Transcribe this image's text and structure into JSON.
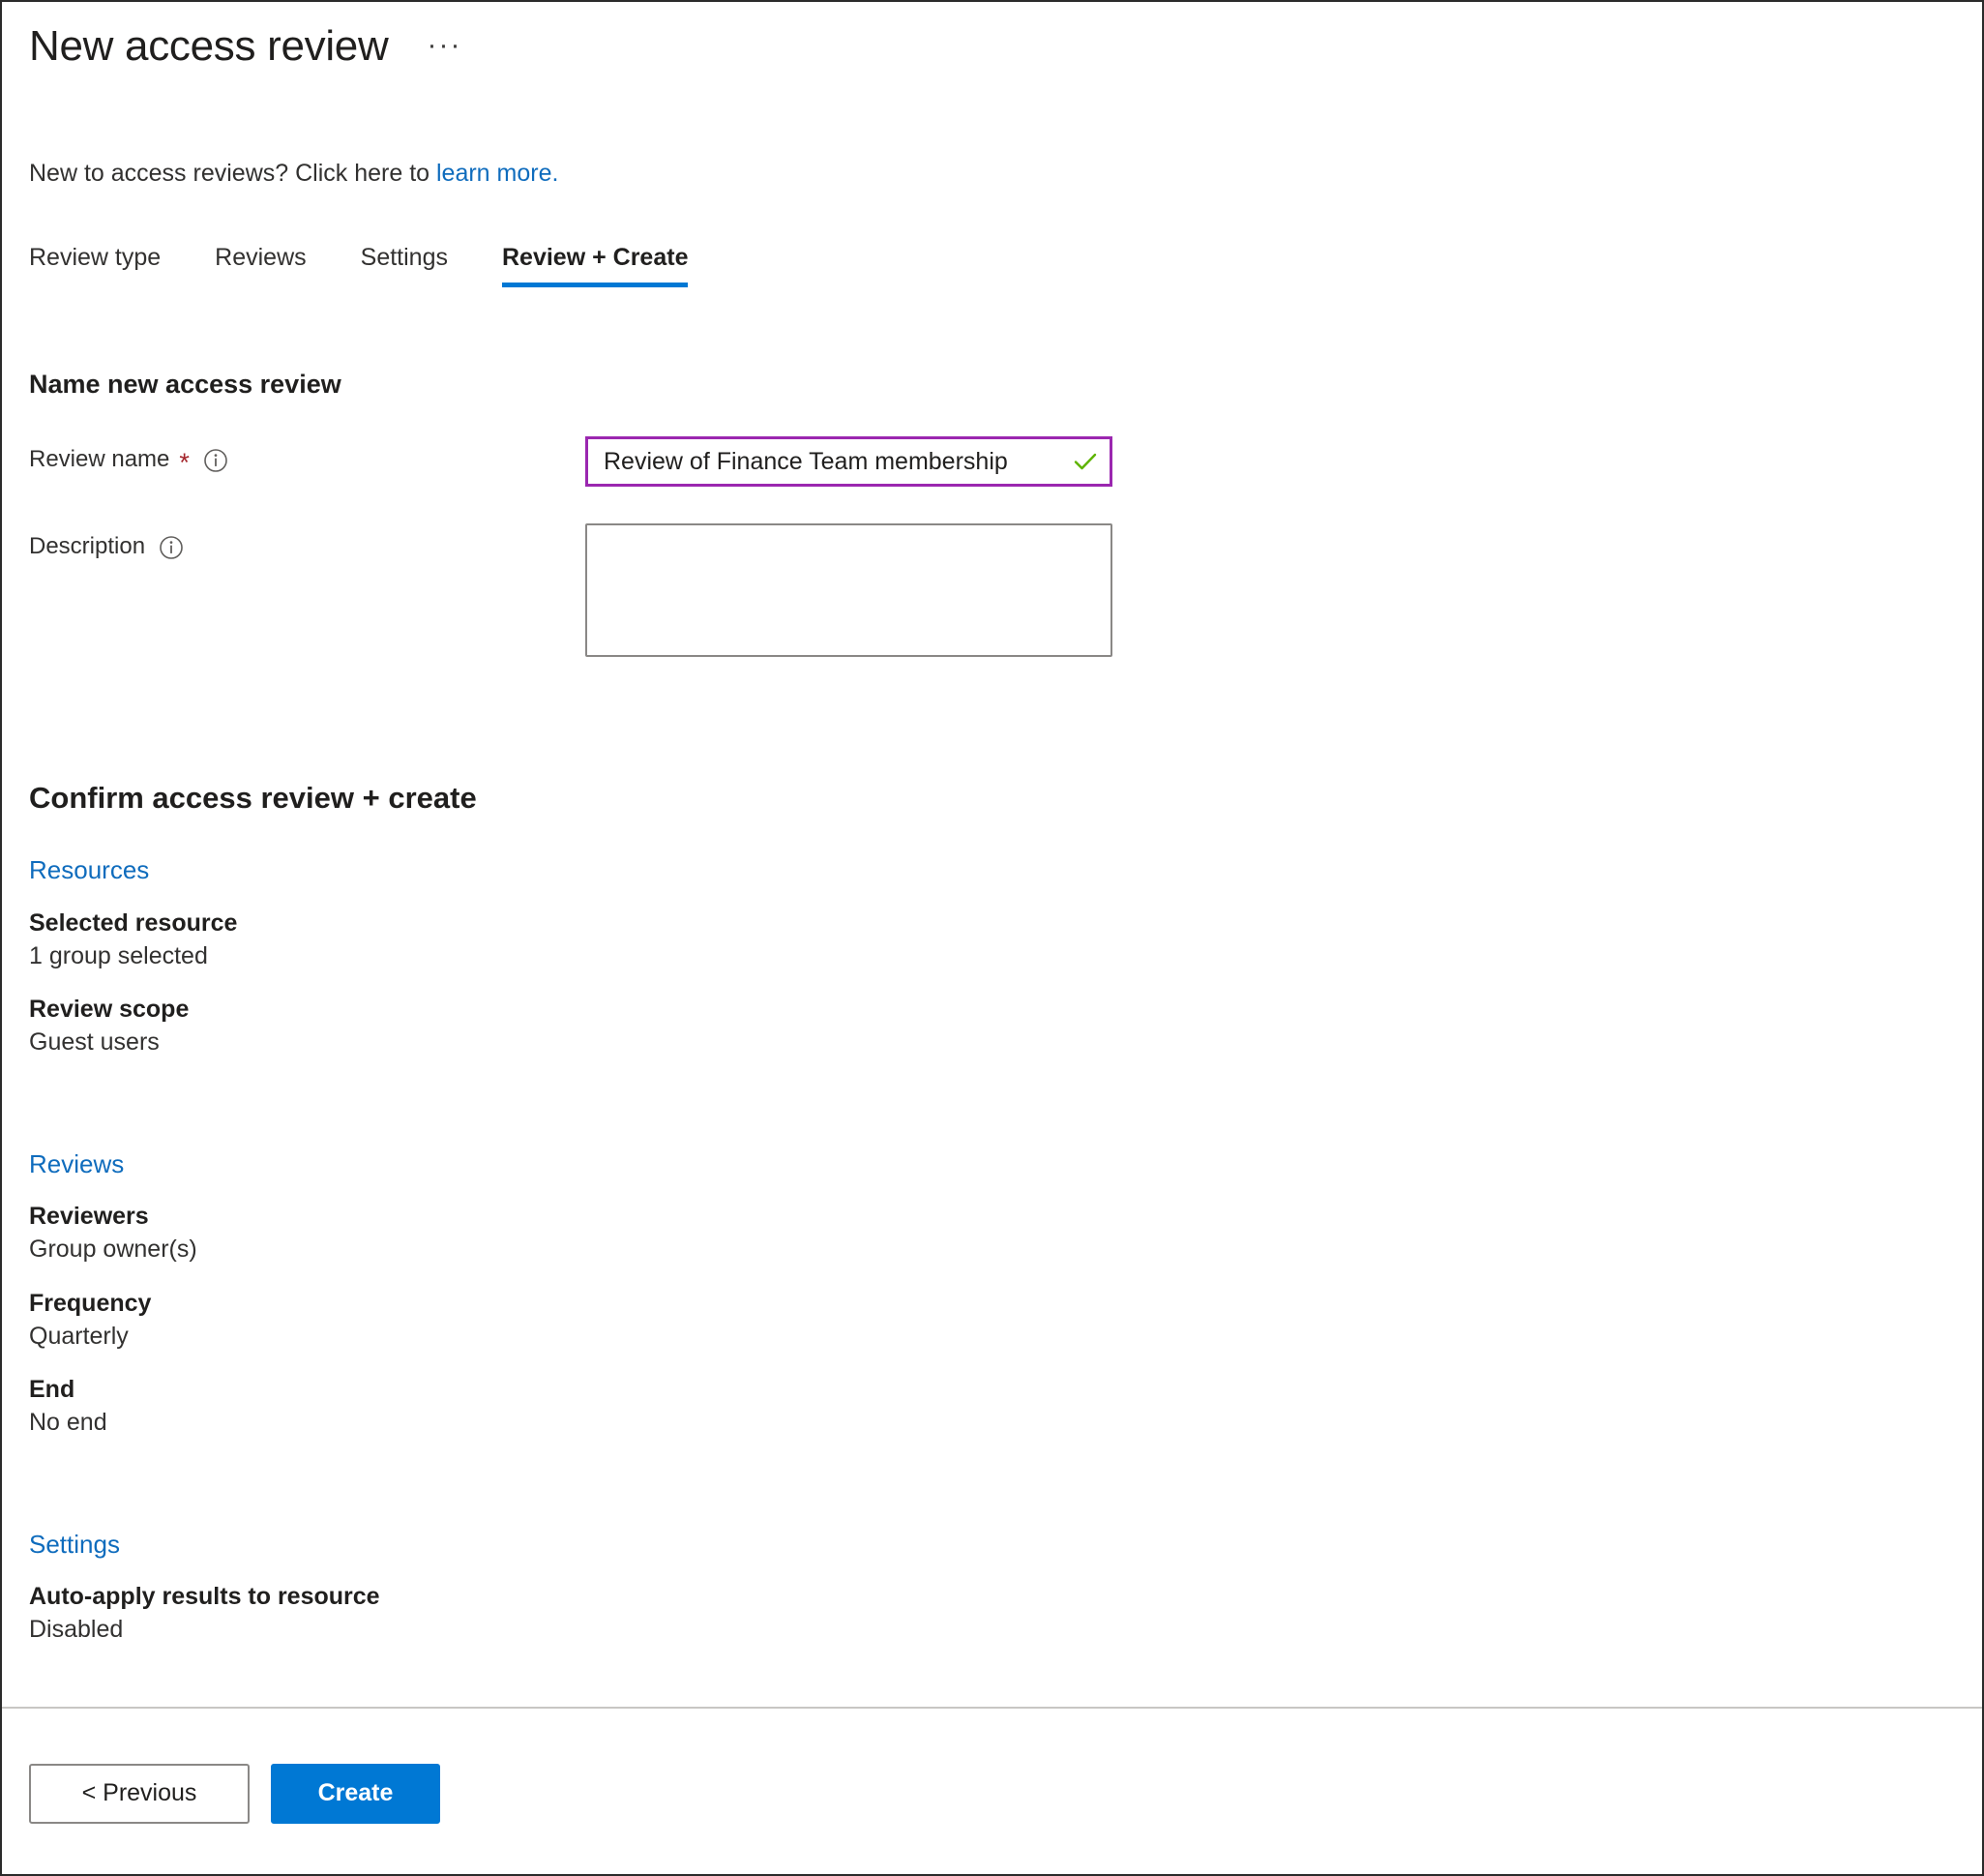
{
  "header": {
    "title": "New access review",
    "more_label": "···",
    "intro_prefix": "New to access reviews? Click here to ",
    "intro_link": "learn more."
  },
  "tabs": [
    {
      "label": "Review type",
      "active": false
    },
    {
      "label": "Reviews",
      "active": false
    },
    {
      "label": "Settings",
      "active": false
    },
    {
      "label": "Review + Create",
      "active": true
    }
  ],
  "name_section": {
    "heading": "Name new access review",
    "review_name_label": "Review name",
    "required_mark": "*",
    "review_name_value": "Review of Finance Team membership",
    "review_name_placeholder": "",
    "description_label": "Description",
    "description_value": "",
    "description_placeholder": ""
  },
  "confirm": {
    "heading": "Confirm access review + create",
    "groups": [
      {
        "link": "Resources",
        "items": [
          {
            "key": "Selected resource",
            "value": "1 group selected"
          },
          {
            "key": "Review scope",
            "value": "Guest users"
          }
        ]
      },
      {
        "link": "Reviews",
        "items": [
          {
            "key": "Reviewers",
            "value": "Group owner(s)"
          },
          {
            "key": "Frequency",
            "value": "Quarterly"
          },
          {
            "key": "End",
            "value": "No end"
          }
        ]
      },
      {
        "link": "Settings",
        "items": [
          {
            "key": "Auto-apply results to resource",
            "value": "Disabled"
          }
        ]
      }
    ]
  },
  "footer": {
    "previous_label": "< Previous",
    "create_label": "Create"
  },
  "colors": {
    "accent_blue": "#0078d4",
    "link_blue": "#0f6cbd",
    "focus_purple": "#9b27b0",
    "valid_green": "#5db300",
    "required_red": "#a4262c",
    "text_primary": "#201f1e",
    "border_gray": "#8a8886"
  }
}
